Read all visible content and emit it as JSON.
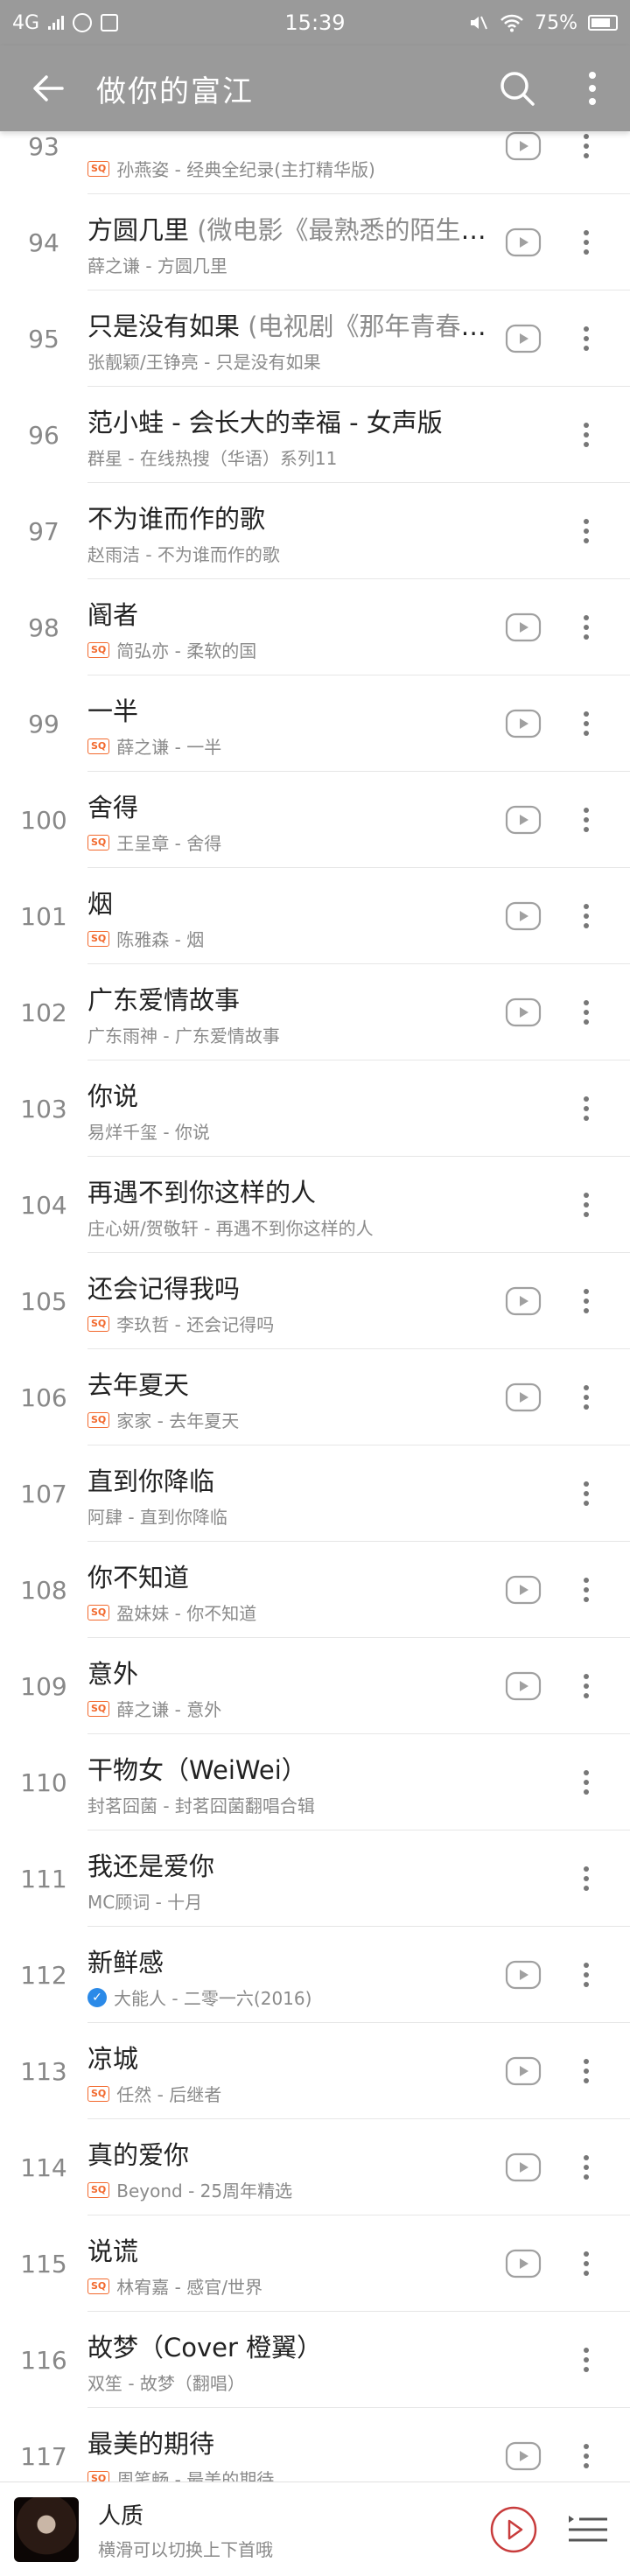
{
  "status_bar": {
    "network": "4G",
    "time": "15:39",
    "battery": "75%"
  },
  "app_bar": {
    "title": "做你的富江",
    "icons": {
      "back": "arrow-left-icon",
      "search": "search-icon",
      "more": "vertical-ellipsis-icon"
    }
  },
  "colors": {
    "header_bg": "#9a9a9a",
    "sq_badge": "#f2692d",
    "verified_badge": "#2b8ae8",
    "play_ring": "#c83c3c"
  },
  "songs": [
    {
      "index": "93",
      "title": "",
      "subtitle": "",
      "artist_album": "孙燕姿 - 经典全纪录(主打精华版)",
      "badge": "SQ",
      "mv": true
    },
    {
      "index": "94",
      "title": "方圆几里",
      "subtitle": " (微电影《最熟悉的陌生人》主题曲)",
      "artist_album": "薛之谦 - 方圆几里",
      "badge": "",
      "mv": true
    },
    {
      "index": "95",
      "title": "只是没有如果",
      "subtitle": " (电视剧《那年青春我们正好》插曲)",
      "artist_album": "张靓颖/王铮亮 - 只是没有如果",
      "badge": "",
      "mv": true
    },
    {
      "index": "96",
      "title": "范小蛙 - 会长大的幸福 - 女声版",
      "subtitle": "",
      "artist_album": "群星 - 在线热搜（华语）系列11",
      "badge": "",
      "mv": false
    },
    {
      "index": "97",
      "title": "不为谁而作的歌",
      "subtitle": "",
      "artist_album": "赵雨洁 - 不为谁而作的歌",
      "badge": "",
      "mv": false
    },
    {
      "index": "98",
      "title": "阍者",
      "subtitle": "",
      "artist_album": "简弘亦 - 柔软的国",
      "badge": "SQ",
      "mv": true
    },
    {
      "index": "99",
      "title": "一半",
      "subtitle": "",
      "artist_album": "薛之谦 - 一半",
      "badge": "SQ",
      "mv": true
    },
    {
      "index": "100",
      "title": "舍得",
      "subtitle": "",
      "artist_album": "王呈章 - 舍得",
      "badge": "SQ",
      "mv": true
    },
    {
      "index": "101",
      "title": "烟",
      "subtitle": "",
      "artist_album": "陈雅森 - 烟",
      "badge": "SQ",
      "mv": true
    },
    {
      "index": "102",
      "title": "广东爱情故事",
      "subtitle": "",
      "artist_album": "广东雨神 - 广东爱情故事",
      "badge": "",
      "mv": true
    },
    {
      "index": "103",
      "title": "你说",
      "subtitle": "",
      "artist_album": "易烊千玺 - 你说",
      "badge": "",
      "mv": false
    },
    {
      "index": "104",
      "title": "再遇不到你这样的人",
      "subtitle": "",
      "artist_album": "庄心妍/贺敬轩 - 再遇不到你这样的人",
      "badge": "",
      "mv": false
    },
    {
      "index": "105",
      "title": "还会记得我吗",
      "subtitle": "",
      "artist_album": "李玖哲 - 还会记得吗",
      "badge": "SQ",
      "mv": true
    },
    {
      "index": "106",
      "title": "去年夏天",
      "subtitle": "",
      "artist_album": "家家 - 去年夏天",
      "badge": "SQ",
      "mv": true
    },
    {
      "index": "107",
      "title": "直到你降临",
      "subtitle": "",
      "artist_album": "阿肆 - 直到你降临",
      "badge": "",
      "mv": false
    },
    {
      "index": "108",
      "title": "你不知道",
      "subtitle": "",
      "artist_album": "盈妹妹 - 你不知道",
      "badge": "SQ",
      "mv": true
    },
    {
      "index": "109",
      "title": "意外",
      "subtitle": "",
      "artist_album": "薛之谦 - 意外",
      "badge": "SQ",
      "mv": true
    },
    {
      "index": "110",
      "title": "干物女（WeiWei）",
      "subtitle": "",
      "artist_album": "封茗囧菌 - 封茗囧菌翻唱合辑",
      "badge": "",
      "mv": false
    },
    {
      "index": "111",
      "title": "我还是爱你",
      "subtitle": "",
      "artist_album": "MC顾词 - 十月",
      "badge": "",
      "mv": false
    },
    {
      "index": "112",
      "title": "新鲜感",
      "subtitle": "",
      "artist_album": "大能人 - 二零一六(2016)",
      "badge": "V",
      "mv": true
    },
    {
      "index": "113",
      "title": "凉城",
      "subtitle": "",
      "artist_album": "任然 - 后继者",
      "badge": "SQ",
      "mv": true
    },
    {
      "index": "114",
      "title": "真的爱你",
      "subtitle": "",
      "artist_album": "Beyond - 25周年精选",
      "badge": "SQ",
      "mv": true
    },
    {
      "index": "115",
      "title": "说谎",
      "subtitle": "",
      "artist_album": "林宥嘉 - 感官/世界",
      "badge": "SQ",
      "mv": true
    },
    {
      "index": "116",
      "title": "故梦（Cover 橙翼）",
      "subtitle": "",
      "artist_album": "双笙 - 故梦（翻唱）",
      "badge": "",
      "mv": false
    },
    {
      "index": "117",
      "title": "最美的期待",
      "subtitle": "",
      "artist_album": "周笔畅 - 最美的期待",
      "badge": "SQ",
      "mv": true
    }
  ],
  "now_playing": {
    "title": "人质",
    "hint": "横滑可以切换上下首哦",
    "icons": {
      "play": "play-circle-icon",
      "queue": "playlist-icon"
    }
  }
}
